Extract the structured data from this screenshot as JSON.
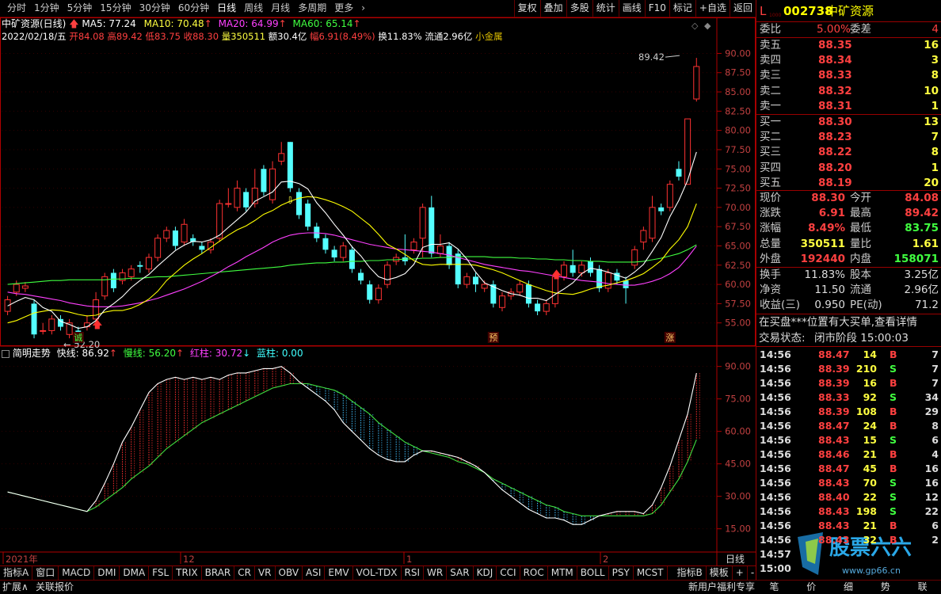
{
  "toolbar": {
    "periods": [
      "分时",
      "1分钟",
      "5分钟",
      "15分钟",
      "30分钟",
      "60分钟",
      "日线",
      "周线",
      "月线",
      "多周期",
      "更多"
    ],
    "active_period": "日线",
    "buttons": [
      "复权",
      "叠加",
      "多股",
      "统计",
      "画线",
      "F10",
      "标记",
      "+自选",
      "返回"
    ]
  },
  "price_header": {
    "title": "中矿资源(日线)",
    "ma5": "MA5: 77.24",
    "ma10": "MA10: 70.48",
    "ma20": "MA20: 64.99",
    "ma60": "MA60: 65.14"
  },
  "ohlc": {
    "date": "2022/02/18/五",
    "open": "开84.08",
    "high": "高89.42",
    "low": "低83.75",
    "close": "收88.30",
    "volume": "量350511",
    "amount": "额30.4亿",
    "change": "幅6.91(8.49%)",
    "turnover": "换11.83%",
    "float": "流通2.96亿",
    "sector": "小金属"
  },
  "price_axis": [
    "90.00",
    "87.50",
    "85.00",
    "82.50",
    "80.00",
    "77.50",
    "75.00",
    "72.50",
    "70.00",
    "67.50",
    "65.00",
    "62.50",
    "60.00",
    "57.50",
    "55.00"
  ],
  "price_annotations": {
    "high": "89.42",
    "low": "52.20",
    "marks": [
      "诚",
      "预",
      "涨"
    ]
  },
  "indicator_header": {
    "name": "简明走势",
    "fast": "快线: 86.92",
    "slow": "慢线: 56.20",
    "red": "红柱: 30.72",
    "blue": "蓝柱: 0.00"
  },
  "indicator_axis": [
    "90.00",
    "75.00",
    "60.00",
    "45.00",
    "30.00",
    "15.00"
  ],
  "date_axis": {
    "labels": [
      "2021年",
      "12",
      "1",
      "2"
    ],
    "period": "日线"
  },
  "indicator_tabs": [
    "指标A",
    "窗口",
    "MACD",
    "DMI",
    "DMA",
    "FSL",
    "TRIX",
    "BRAR",
    "CR",
    "VR",
    "OBV",
    "ASI",
    "EMV",
    "VOL-TDX",
    "RSI",
    "WR",
    "SAR",
    "KDJ",
    "CCI",
    "ROC",
    "MTM",
    "BOLL",
    "PSY",
    "MCST"
  ],
  "indicator_tabs_right": [
    "指标B",
    "模板",
    "+",
    "-"
  ],
  "status_bar": {
    "left": [
      "扩展∧",
      "关联报价"
    ],
    "right": "新用户福利专享",
    "right_tabs": [
      "笔",
      "价",
      "细",
      "势",
      "联"
    ],
    "watermark": "股票六六 www.gp66.cn"
  },
  "quote": {
    "code": "002738",
    "name": "中矿资源",
    "prefix": "L",
    "weibi_label": "委比",
    "weibi": "5.00%",
    "weicha_label": "委差",
    "weicha": "4",
    "asks": [
      {
        "label": "卖五",
        "price": "88.35",
        "vol": "16"
      },
      {
        "label": "卖四",
        "price": "88.34",
        "vol": "3"
      },
      {
        "label": "卖三",
        "price": "88.33",
        "vol": "8"
      },
      {
        "label": "卖二",
        "price": "88.32",
        "vol": "10"
      },
      {
        "label": "卖一",
        "price": "88.31",
        "vol": "1"
      }
    ],
    "bids": [
      {
        "label": "买一",
        "price": "88.30",
        "vol": "13"
      },
      {
        "label": "买二",
        "price": "88.23",
        "vol": "7"
      },
      {
        "label": "买三",
        "price": "88.22",
        "vol": "8"
      },
      {
        "label": "买四",
        "price": "88.20",
        "vol": "1"
      },
      {
        "label": "买五",
        "price": "88.19",
        "vol": "20"
      }
    ],
    "stats": [
      {
        "l1": "现价",
        "v1": "88.30",
        "l2": "今开",
        "v2": "84.08"
      },
      {
        "l1": "涨跌",
        "v1": "6.91",
        "l2": "最高",
        "v2": "89.42"
      },
      {
        "l1": "涨幅",
        "v1": "8.49%",
        "l2": "最低",
        "v2": "83.75"
      },
      {
        "l1": "总量",
        "v1": "350511",
        "l2": "量比",
        "v2": "1.61"
      },
      {
        "l1": "外盘",
        "v1": "192440",
        "l2": "内盘",
        "v2": "158071"
      }
    ],
    "stats2": [
      {
        "l1": "换手",
        "v1": "11.83%",
        "l2": "股本",
        "v2": "3.25亿"
      },
      {
        "l1": "净资",
        "v1": "11.50",
        "l2": "流通",
        "v2": "2.96亿"
      },
      {
        "l1": "收益(三)",
        "v1": "0.950",
        "l2": "PE(动)",
        "v2": "71.2"
      }
    ],
    "notice": "在买盘***位置有大买单,查看详情",
    "trade_state_label": "交易状态:",
    "trade_state": "闭市阶段 15:00:03",
    "ticks": [
      {
        "t": "14:56",
        "p": "88.47",
        "v": "14",
        "s": "B",
        "n": "7"
      },
      {
        "t": "14:56",
        "p": "88.39",
        "v": "210",
        "s": "S",
        "n": "7"
      },
      {
        "t": "14:56",
        "p": "88.39",
        "v": "16",
        "s": "B",
        "n": "7"
      },
      {
        "t": "14:56",
        "p": "88.33",
        "v": "92",
        "s": "S",
        "n": "34"
      },
      {
        "t": "14:56",
        "p": "88.39",
        "v": "108",
        "s": "B",
        "n": "29"
      },
      {
        "t": "14:56",
        "p": "88.47",
        "v": "24",
        "s": "B",
        "n": "8"
      },
      {
        "t": "14:56",
        "p": "88.43",
        "v": "15",
        "s": "S",
        "n": "6"
      },
      {
        "t": "14:56",
        "p": "88.46",
        "v": "21",
        "s": "B",
        "n": "4"
      },
      {
        "t": "14:56",
        "p": "88.47",
        "v": "45",
        "s": "B",
        "n": "16"
      },
      {
        "t": "14:56",
        "p": "88.43",
        "v": "70",
        "s": "S",
        "n": "16"
      },
      {
        "t": "14:56",
        "p": "88.40",
        "v": "22",
        "s": "S",
        "n": "12"
      },
      {
        "t": "14:56",
        "p": "88.43",
        "v": "198",
        "s": "S",
        "n": "22"
      },
      {
        "t": "14:56",
        "p": "88.43",
        "v": "21",
        "s": "B",
        "n": "6"
      },
      {
        "t": "14:56",
        "p": "88.43",
        "v": "32",
        "s": "B",
        "n": "2"
      },
      {
        "t": "14:57",
        "p": "",
        "v": "",
        "s": "",
        "n": ""
      },
      {
        "t": "15:00",
        "p": "",
        "v": "",
        "s": "",
        "n": ""
      }
    ]
  },
  "chart_data": {
    "type": "candlestick",
    "candles": [
      {
        "o": 56.5,
        "c": 58.0,
        "h": 58.5,
        "l": 56.0
      },
      {
        "o": 59.0,
        "c": 60.0,
        "h": 60.5,
        "l": 58.5
      },
      {
        "o": 59.5,
        "c": 59.8,
        "h": 60.3,
        "l": 59.0
      },
      {
        "o": 57.5,
        "c": 53.5,
        "h": 58.0,
        "l": 53.0
      },
      {
        "o": 54.0,
        "c": 54.0,
        "h": 55.0,
        "l": 53.5
      },
      {
        "o": 54.0,
        "c": 55.5,
        "h": 56.0,
        "l": 53.5
      },
      {
        "o": 55.5,
        "c": 54.5,
        "h": 56.0,
        "l": 54.0
      },
      {
        "o": 53.5,
        "c": 55.0,
        "h": 55.5,
        "l": 53.0
      },
      {
        "o": 54.0,
        "c": 52.8,
        "h": 54.5,
        "l": 52.2
      },
      {
        "o": 54.5,
        "c": 55.0,
        "h": 56.0,
        "l": 54.0
      },
      {
        "o": 55.5,
        "c": 58.0,
        "h": 59.0,
        "l": 55.0
      },
      {
        "o": 58.5,
        "c": 61.0,
        "h": 61.5,
        "l": 58.0
      },
      {
        "o": 61.5,
        "c": 59.5,
        "h": 62.0,
        "l": 59.0
      },
      {
        "o": 60.5,
        "c": 61.5,
        "h": 62.0,
        "l": 60.0
      },
      {
        "o": 61.0,
        "c": 62.0,
        "h": 62.5,
        "l": 60.5
      },
      {
        "o": 62.5,
        "c": 62.3,
        "h": 63.0,
        "l": 61.5
      },
      {
        "o": 62.0,
        "c": 63.5,
        "h": 64.0,
        "l": 61.5
      },
      {
        "o": 63.5,
        "c": 66.0,
        "h": 66.5,
        "l": 63.0
      },
      {
        "o": 66.0,
        "c": 67.0,
        "h": 67.5,
        "l": 65.5
      },
      {
        "o": 67.0,
        "c": 65.0,
        "h": 67.5,
        "l": 64.5
      },
      {
        "o": 65.5,
        "c": 67.8,
        "h": 68.5,
        "l": 65.0
      },
      {
        "o": 66.0,
        "c": 65.5,
        "h": 66.5,
        "l": 65.0
      },
      {
        "o": 65.0,
        "c": 64.5,
        "h": 65.5,
        "l": 64.0
      },
      {
        "o": 64.5,
        "c": 65.5,
        "h": 66.0,
        "l": 64.0
      },
      {
        "o": 66.0,
        "c": 70.5,
        "h": 71.0,
        "l": 65.5
      },
      {
        "o": 70.5,
        "c": 70.5,
        "h": 72.5,
        "l": 70.0
      },
      {
        "o": 70.0,
        "c": 72.5,
        "h": 73.5,
        "l": 69.5
      },
      {
        "o": 72.0,
        "c": 70.0,
        "h": 72.5,
        "l": 69.5
      },
      {
        "o": 70.5,
        "c": 72.5,
        "h": 75.0,
        "l": 70.0
      },
      {
        "o": 75.0,
        "c": 72.0,
        "h": 75.5,
        "l": 71.5
      },
      {
        "o": 71.0,
        "c": 75.0,
        "h": 76.0,
        "l": 70.5
      },
      {
        "o": 76.0,
        "c": 77.0,
        "h": 78.5,
        "l": 75.5
      },
      {
        "o": 78.5,
        "c": 72.5,
        "h": 78.5,
        "l": 72.0
      },
      {
        "o": 72.0,
        "c": 69.0,
        "h": 72.5,
        "l": 68.5
      },
      {
        "o": 70.5,
        "c": 67.5,
        "h": 71.0,
        "l": 67.0
      },
      {
        "o": 67.5,
        "c": 66.0,
        "h": 68.0,
        "l": 65.5
      },
      {
        "o": 66.0,
        "c": 64.5,
        "h": 66.5,
        "l": 64.0
      },
      {
        "o": 64.5,
        "c": 63.5,
        "h": 65.0,
        "l": 63.0
      },
      {
        "o": 63.5,
        "c": 65.0,
        "h": 65.5,
        "l": 63.0
      },
      {
        "o": 64.5,
        "c": 62.0,
        "h": 65.0,
        "l": 61.5
      },
      {
        "o": 61.5,
        "c": 60.5,
        "h": 62.0,
        "l": 60.0
      },
      {
        "o": 60.0,
        "c": 58.0,
        "h": 60.5,
        "l": 57.5
      },
      {
        "o": 58.0,
        "c": 59.5,
        "h": 60.0,
        "l": 57.5
      },
      {
        "o": 60.0,
        "c": 62.5,
        "h": 63.0,
        "l": 59.5
      },
      {
        "o": 63.0,
        "c": 63.5,
        "h": 64.0,
        "l": 62.5
      },
      {
        "o": 63.5,
        "c": 63.0,
        "h": 66.5,
        "l": 62.5
      },
      {
        "o": 64.5,
        "c": 65.5,
        "h": 66.0,
        "l": 64.0
      },
      {
        "o": 66.0,
        "c": 70.0,
        "h": 70.5,
        "l": 63.5
      },
      {
        "o": 70.0,
        "c": 64.0,
        "h": 71.5,
        "l": 63.5
      },
      {
        "o": 64.0,
        "c": 65.0,
        "h": 66.5,
        "l": 63.5
      },
      {
        "o": 65.0,
        "c": 62.5,
        "h": 65.5,
        "l": 62.0
      },
      {
        "o": 64.0,
        "c": 60.0,
        "h": 64.5,
        "l": 59.5
      },
      {
        "o": 60.0,
        "c": 61.0,
        "h": 61.5,
        "l": 59.5
      },
      {
        "o": 61.0,
        "c": 60.0,
        "h": 61.5,
        "l": 59.0
      },
      {
        "o": 59.5,
        "c": 60.0,
        "h": 60.5,
        "l": 59.0
      },
      {
        "o": 60.0,
        "c": 57.5,
        "h": 60.5,
        "l": 57.0
      },
      {
        "o": 57.0,
        "c": 58.5,
        "h": 59.0,
        "l": 56.5
      },
      {
        "o": 58.5,
        "c": 59.0,
        "h": 59.5,
        "l": 58.0
      },
      {
        "o": 59.0,
        "c": 60.0,
        "h": 60.5,
        "l": 58.5
      },
      {
        "o": 60.0,
        "c": 57.5,
        "h": 60.5,
        "l": 57.0
      },
      {
        "o": 57.5,
        "c": 56.5,
        "h": 58.0,
        "l": 56.0
      },
      {
        "o": 56.5,
        "c": 57.5,
        "h": 58.0,
        "l": 56.0
      },
      {
        "o": 57.5,
        "c": 61.0,
        "h": 61.5,
        "l": 57.0
      },
      {
        "o": 61.0,
        "c": 62.5,
        "h": 63.0,
        "l": 60.5
      },
      {
        "o": 62.5,
        "c": 61.5,
        "h": 64.5,
        "l": 61.0
      },
      {
        "o": 61.5,
        "c": 62.5,
        "h": 63.0,
        "l": 61.0
      },
      {
        "o": 63.0,
        "c": 61.5,
        "h": 63.5,
        "l": 61.0
      },
      {
        "o": 62.0,
        "c": 59.5,
        "h": 62.5,
        "l": 59.0
      },
      {
        "o": 59.5,
        "c": 61.5,
        "h": 62.0,
        "l": 59.0
      },
      {
        "o": 61.5,
        "c": 60.5,
        "h": 62.0,
        "l": 60.0
      },
      {
        "o": 60.5,
        "c": 59.5,
        "h": 61.0,
        "l": 57.5
      },
      {
        "o": 62.5,
        "c": 64.5,
        "h": 65.0,
        "l": 62.0
      },
      {
        "o": 65.5,
        "c": 67.0,
        "h": 67.5,
        "l": 64.5
      },
      {
        "o": 66.0,
        "c": 70.0,
        "h": 71.5,
        "l": 65.5
      },
      {
        "o": 70.0,
        "c": 69.5,
        "h": 70.5,
        "l": 69.0
      },
      {
        "o": 70.0,
        "c": 73.0,
        "h": 73.5,
        "l": 69.5
      },
      {
        "o": 75.0,
        "c": 74.0,
        "h": 76.0,
        "l": 73.5
      },
      {
        "o": 73.0,
        "c": 81.5,
        "h": 81.5,
        "l": 73.0
      },
      {
        "o": 84.08,
        "c": 88.3,
        "h": 89.42,
        "l": 83.75
      }
    ],
    "ma5": [
      57.2,
      57.8,
      58.3,
      58.0,
      57.0,
      56.5,
      55.2,
      54.8,
      54.3,
      54.5,
      55.3,
      56.7,
      57.5,
      58.4,
      59.6,
      60.5,
      61.3,
      62.4,
      63.4,
      64.4,
      65.1,
      65.6,
      65.5,
      65.8,
      66.4,
      67.4,
      68.4,
      69.4,
      70.8,
      71.4,
      72.0,
      73.3,
      73.4,
      73.1,
      72.4,
      70.6,
      69.3,
      67.8,
      66.4,
      64.9,
      63.7,
      62.2,
      61.0,
      60.6,
      60.9,
      61.4,
      62.6,
      64.8,
      65.2,
      65.2,
      65.4,
      64.6,
      63.3,
      61.6,
      60.2,
      59.7,
      59.2,
      58.8,
      58.6,
      58.2,
      58.2,
      57.9,
      58.7,
      59.4,
      60.2,
      61.4,
      62.1,
      61.9,
      61.6,
      61.2,
      60.8,
      61.6,
      62.6,
      64.3,
      66.1,
      68.8,
      70.9,
      73.5,
      77.2
    ],
    "ma10": [
      55.0,
      55.3,
      55.8,
      56.3,
      56.5,
      56.7,
      56.6,
      56.4,
      56.1,
      55.9,
      56.0,
      56.4,
      56.6,
      56.6,
      56.9,
      57.4,
      58.1,
      59.1,
      60.5,
      61.5,
      62.5,
      63.3,
      64.0,
      64.8,
      65.6,
      66.4,
      67.1,
      67.6,
      68.3,
      69.1,
      69.6,
      70.3,
      70.8,
      71.2,
      71.4,
      71.3,
      71.0,
      70.6,
      70.1,
      69.5,
      68.6,
      67.7,
      66.5,
      65.2,
      64.6,
      63.9,
      63.1,
      62.6,
      62.5,
      62.6,
      62.6,
      62.6,
      62.6,
      62.5,
      62.2,
      61.9,
      61.5,
      61.0,
      60.5,
      60.0,
      59.6,
      59.2,
      58.9,
      58.8,
      58.7,
      59.0,
      59.4,
      59.7,
      59.9,
      60.2,
      60.5,
      60.9,
      61.4,
      62.2,
      63.1,
      64.6,
      65.8,
      67.5,
      70.48
    ],
    "ma20": [
      59.0,
      58.8,
      58.7,
      58.5,
      58.3,
      58.1,
      57.9,
      57.6,
      57.4,
      57.2,
      57.1,
      57.1,
      57.1,
      57.2,
      57.4,
      57.6,
      57.9,
      58.2,
      58.6,
      59.0,
      59.4,
      59.9,
      60.4,
      61.0,
      61.6,
      62.3,
      62.9,
      63.6,
      64.2,
      64.8,
      65.5,
      66.0,
      66.4,
      66.6,
      66.7,
      66.7,
      66.6,
      66.4,
      66.1,
      65.8,
      65.5,
      65.2,
      65.0,
      64.8,
      64.6,
      64.5,
      64.4,
      64.3,
      64.2,
      64.0,
      63.8,
      63.5,
      63.2,
      62.9,
      62.6,
      62.4,
      62.2,
      62.0,
      61.8,
      61.7,
      61.5,
      61.3,
      61.1,
      60.9,
      60.7,
      60.5,
      60.4,
      60.3,
      60.1,
      60.0,
      59.9,
      59.9,
      60.1,
      60.4,
      60.8,
      61.4,
      62.2,
      63.5,
      64.99
    ],
    "ma60": [
      60.0,
      60.1,
      60.2,
      60.3,
      60.4,
      60.5,
      60.5,
      60.6,
      60.6,
      60.6,
      60.6,
      60.6,
      60.7,
      60.7,
      60.8,
      60.8,
      60.9,
      61.0,
      61.0,
      61.1,
      61.2,
      61.3,
      61.4,
      61.5,
      61.6,
      61.7,
      61.8,
      61.9,
      62.0,
      62.1,
      62.2,
      62.3,
      62.5,
      62.6,
      62.7,
      62.8,
      62.8,
      62.9,
      62.9,
      63.0,
      63.0,
      63.1,
      63.1,
      63.2,
      63.2,
      63.3,
      63.3,
      63.4,
      63.4,
      63.5,
      63.5,
      63.6,
      63.6,
      63.6,
      63.6,
      63.5,
      63.5,
      63.5,
      63.4,
      63.4,
      63.3,
      63.3,
      63.2,
      63.2,
      63.1,
      63.1,
      63.0,
      63.0,
      62.9,
      62.9,
      62.9,
      62.9,
      63.0,
      63.2,
      63.4,
      63.7,
      64.0,
      64.5,
      65.14
    ],
    "fast": [
      32,
      31,
      30,
      29,
      28,
      27,
      26,
      25,
      24,
      23,
      28,
      36,
      45,
      55,
      62,
      70,
      78,
      82,
      84,
      85,
      84,
      85,
      84,
      85,
      84,
      86,
      87,
      87,
      88,
      89,
      89,
      90,
      87,
      83,
      80,
      77,
      74,
      70,
      64,
      60,
      56,
      52,
      49,
      47,
      46,
      46,
      49,
      51,
      51,
      50,
      49,
      48,
      46,
      44,
      41,
      37,
      33,
      30,
      27,
      24,
      22,
      20,
      20,
      19,
      17,
      17,
      19,
      21,
      22,
      23,
      23,
      23,
      22,
      26,
      34,
      44,
      56,
      68,
      86.92
    ],
    "slow": [
      32,
      31,
      30,
      29,
      28,
      27,
      26,
      25,
      24,
      23,
      25,
      28,
      31,
      34,
      38,
      41,
      44,
      48,
      52,
      55,
      58,
      61,
      64,
      66,
      68,
      70,
      72,
      74,
      76,
      78,
      80,
      81,
      82,
      82,
      82,
      81,
      80,
      79,
      77,
      74,
      71,
      68,
      64,
      61,
      58,
      55,
      53,
      51,
      50,
      49,
      48,
      46,
      45,
      43,
      41,
      38,
      36,
      34,
      32,
      30,
      28,
      26,
      25,
      23,
      22,
      21,
      21,
      21,
      21,
      21,
      21,
      21,
      21,
      22,
      26,
      32,
      38,
      46,
      56.2
    ],
    "ylim_price": [
      52.5,
      92.0
    ],
    "ylim_indicator": [
      5,
      95
    ],
    "title": "中矿资源(日线)"
  },
  "colors": {
    "up": "#ff3232",
    "down": "#54ffff",
    "ma5": "#ffffff",
    "ma10": "#ffff00",
    "ma20": "#ff40ff",
    "ma60": "#40ff40",
    "panel_border": "#b00000"
  }
}
